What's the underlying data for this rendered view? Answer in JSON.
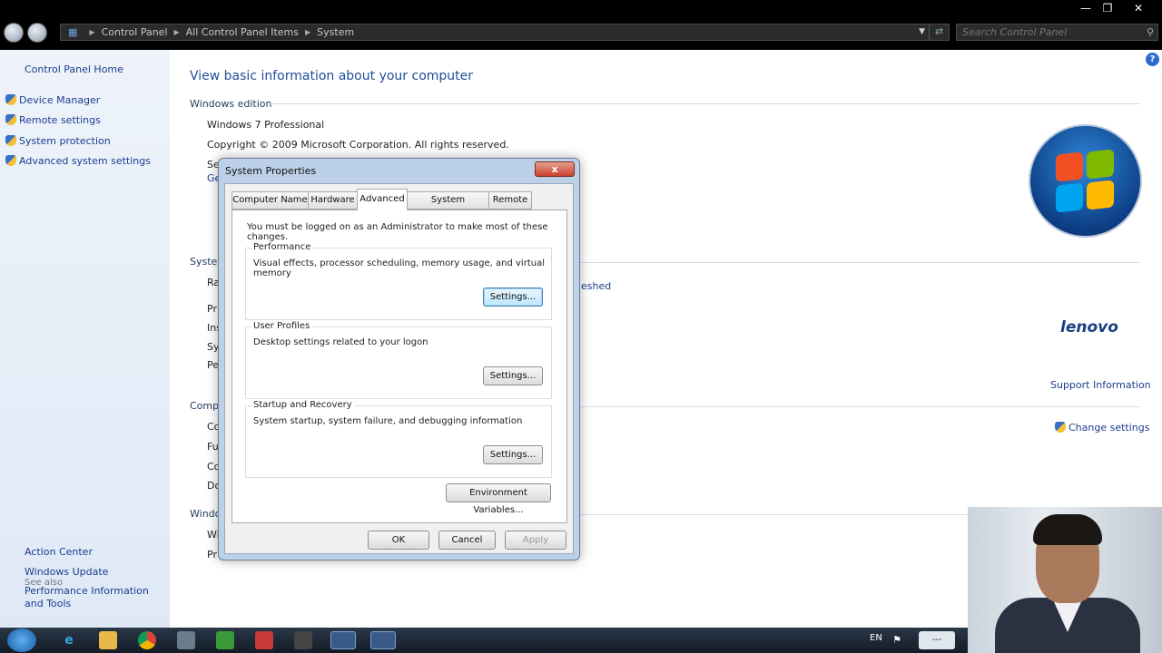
{
  "addressbar": {
    "breadcrumbs": [
      "Control Panel",
      "All Control Panel Items",
      "System"
    ],
    "search_placeholder": "Search Control Panel"
  },
  "left_pane": {
    "home": "Control Panel Home",
    "links": [
      "Device Manager",
      "Remote settings",
      "System protection",
      "Advanced system settings"
    ],
    "see_also_heading": "See also",
    "see_also": [
      "Action Center",
      "Windows Update",
      "Performance Information and Tools"
    ]
  },
  "main": {
    "title": "View basic information about your computer",
    "windows_edition_heading": "Windows edition",
    "edition": "Windows 7 Professional",
    "copyright": "Copyright © 2009 Microsoft Corporation.  All rights reserved.",
    "partial_left_labels": [
      "Se",
      "Ge",
      "System",
      "Ra",
      "Pr",
      "Ins",
      "Sy",
      "Pe",
      "Comp",
      "Co",
      "Fu",
      "Co",
      "Do",
      "Windo",
      "Wi",
      "Pr"
    ],
    "partial_right_link": "eshed",
    "brand_text": "lenovo",
    "support_link": "Support Information",
    "change_settings_link": "Change settings"
  },
  "dialog": {
    "title": "System Properties",
    "close_label": "x",
    "tabs": [
      "Computer Name",
      "Hardware",
      "Advanced",
      "System Protection",
      "Remote"
    ],
    "active_tab": "Advanced",
    "admin_note": "You must be logged on as an Administrator to make most of these changes.",
    "groups": [
      {
        "title": "Performance",
        "desc": "Visual effects, processor scheduling, memory usage, and virtual memory",
        "button": "Settings..."
      },
      {
        "title": "User Profiles",
        "desc": "Desktop settings related to your logon",
        "button": "Settings..."
      },
      {
        "title": "Startup and Recovery",
        "desc": "System startup, system failure, and debugging information",
        "button": "Settings..."
      }
    ],
    "env_button": "Environment Variables...",
    "ok": "OK",
    "cancel": "Cancel",
    "apply": "Apply"
  },
  "taskbar": {
    "language": "EN"
  }
}
